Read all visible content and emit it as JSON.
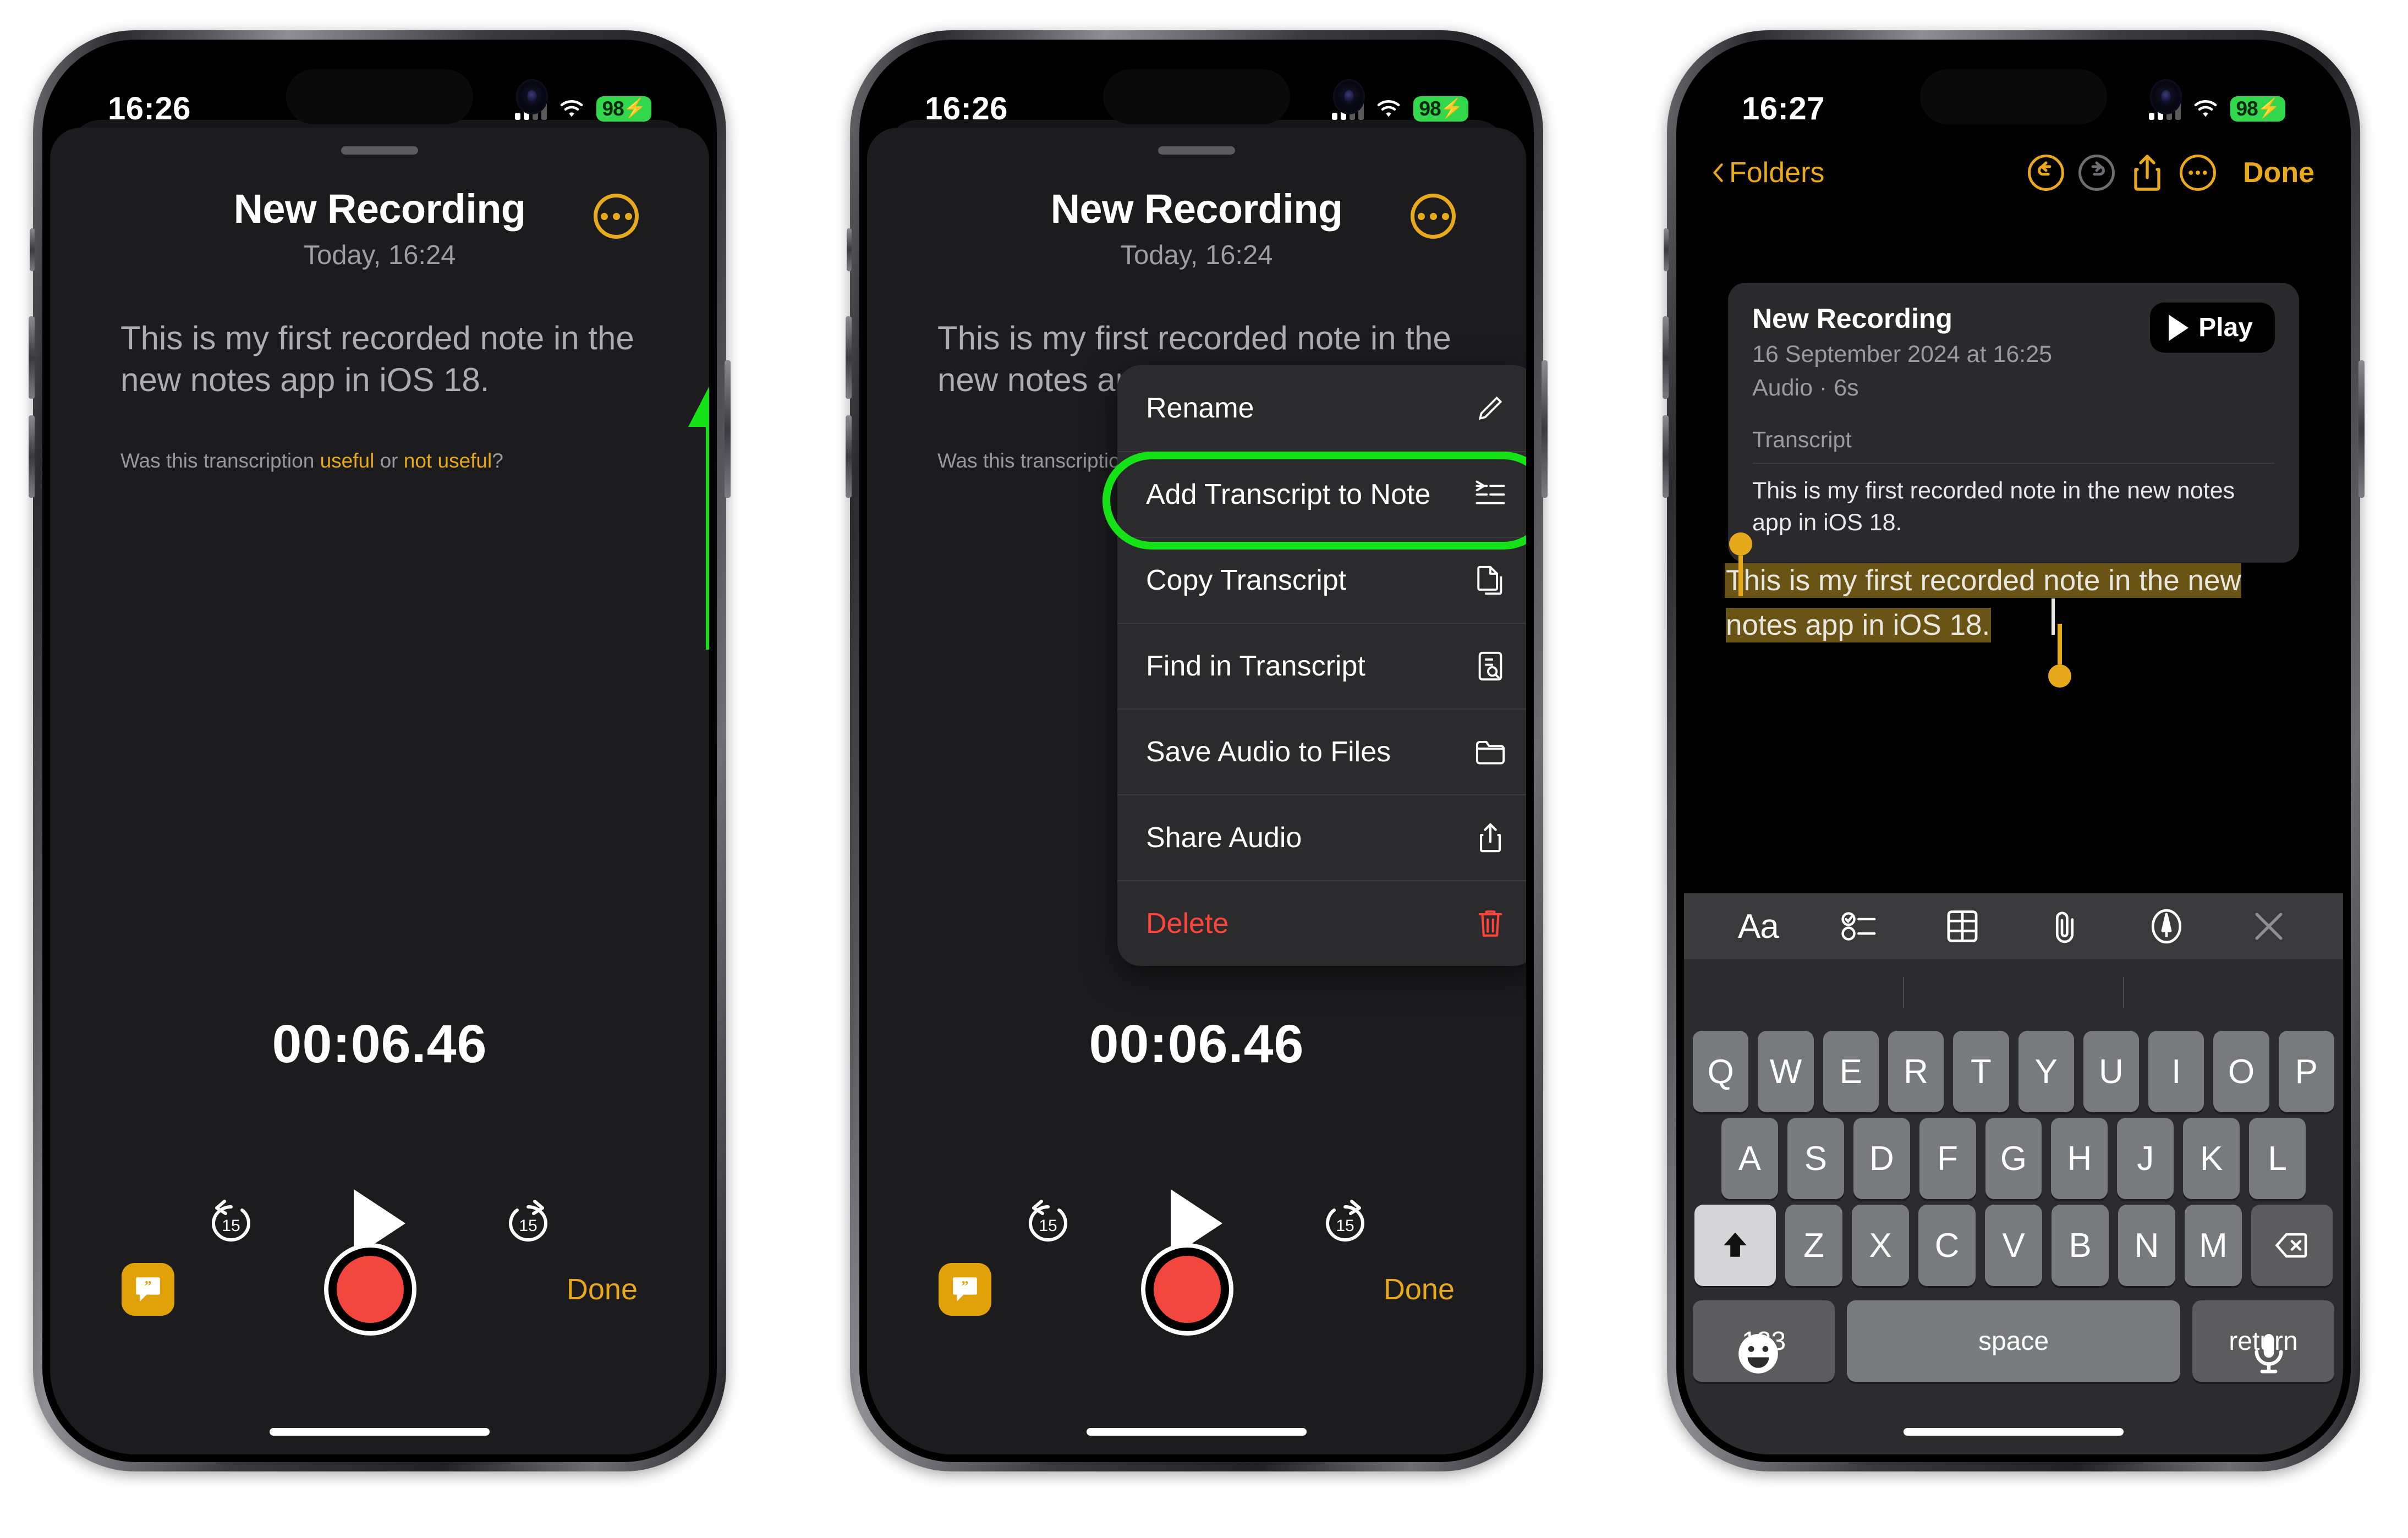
{
  "phones": [
    {
      "id": "phone-1",
      "status_bar": {
        "time": "16:26",
        "battery_level": "98",
        "battery_charging": true,
        "battery_color": "#32d74b",
        "wifi": "wifi-icon",
        "cellular": "cellular-bars-icon"
      },
      "screen": "voice-memo-player",
      "recording": {
        "title": "New Recording",
        "subtitle": "Today, 16:24",
        "transcript": "This is my first recorded note in the new notes app in iOS 18.",
        "feedback_prefix": "Was this transcription ",
        "feedback_useful": "useful",
        "feedback_or": " or ",
        "feedback_not_useful": "not useful",
        "feedback_suffix": "?",
        "timer": "00:06.46",
        "skip_back_label": "15",
        "skip_forward_label": "15",
        "done_label": "Done",
        "more_button": "more-ellipsis-button",
        "transcript_button": "transcript-quote-button",
        "record_button": "record-button"
      },
      "annotation": {
        "type": "arrow",
        "color": "#15e318",
        "points_to": "more-ellipsis-button"
      }
    },
    {
      "id": "phone-2",
      "status_bar": {
        "time": "16:26",
        "battery_level": "98",
        "battery_charging": true,
        "battery_color": "#32d74b"
      },
      "screen": "voice-memo-player-with-context-menu",
      "recording": {
        "title": "New Recording",
        "subtitle": "Today, 16:24",
        "transcript": "This is my first recorded note in the new notes app in iOS 18.",
        "feedback_prefix": "Was this transcription ",
        "timer": "00:06.46",
        "done_label": "Done"
      },
      "context_menu": {
        "highlighted_index": 1,
        "highlight_color": "#15e318",
        "items": [
          {
            "label": "Rename",
            "icon": "pencil-icon",
            "destructive": false
          },
          {
            "label": "Add Transcript to Note",
            "icon": "add-to-note-icon",
            "destructive": false
          },
          {
            "label": "Copy Transcript",
            "icon": "copy-document-icon",
            "destructive": false
          },
          {
            "label": "Find in Transcript",
            "icon": "document-search-icon",
            "destructive": false
          },
          {
            "label": "Save Audio to Files",
            "icon": "folder-icon",
            "destructive": false
          },
          {
            "label": "Share Audio",
            "icon": "share-icon",
            "destructive": false
          },
          {
            "label": "Delete",
            "icon": "trash-icon",
            "destructive": true
          }
        ]
      }
    },
    {
      "id": "phone-3",
      "status_bar": {
        "time": "16:27",
        "battery_level": "98",
        "battery_charging": true,
        "battery_color": "#32d74b"
      },
      "screen": "notes-editor",
      "nav": {
        "back_label": "Folders",
        "done_label": "Done",
        "undo_icon": "undo-icon",
        "undo_enabled": true,
        "redo_icon": "redo-icon",
        "redo_enabled": false,
        "share_icon": "share-icon",
        "more_icon": "more-ellipsis-icon",
        "accent_color": "#e8a91d",
        "disabled_color": "#6d6d72"
      },
      "audio_card": {
        "title": "New Recording",
        "date": "16 September 2024 at 16:25",
        "meta": "Audio · 6s",
        "play_label": "Play",
        "transcript_label": "Transcript",
        "transcript_text": "This is my first recorded note in the new notes app in iOS 18."
      },
      "note_body": {
        "selected_text": "This is my first recorded note in the new notes app in iOS 18.",
        "selection_highlight": "#6a5415",
        "handle_color": "#e8a91d"
      },
      "keyboard_toolbar": [
        {
          "name": "format-text-icon",
          "label": "Aa"
        },
        {
          "name": "checklist-icon",
          "label": ""
        },
        {
          "name": "table-icon",
          "label": ""
        },
        {
          "name": "attachment-icon",
          "label": ""
        },
        {
          "name": "markup-pen-icon",
          "label": ""
        },
        {
          "name": "close-icon",
          "label": ""
        }
      ],
      "keyboard": {
        "row1": [
          "Q",
          "W",
          "E",
          "R",
          "T",
          "Y",
          "U",
          "I",
          "O",
          "P"
        ],
        "row2": [
          "A",
          "S",
          "D",
          "F",
          "G",
          "H",
          "J",
          "K",
          "L"
        ],
        "row3": [
          "Z",
          "X",
          "C",
          "V",
          "B",
          "N",
          "M"
        ],
        "shift_icon": "shift-up-arrow-icon",
        "backspace_icon": "backspace-delete-icon",
        "num_label": "123",
        "space_label": "space",
        "return_label": "return",
        "emoji_icon": "emoji-smiley-icon",
        "dictation_icon": "microphone-icon"
      }
    }
  ]
}
